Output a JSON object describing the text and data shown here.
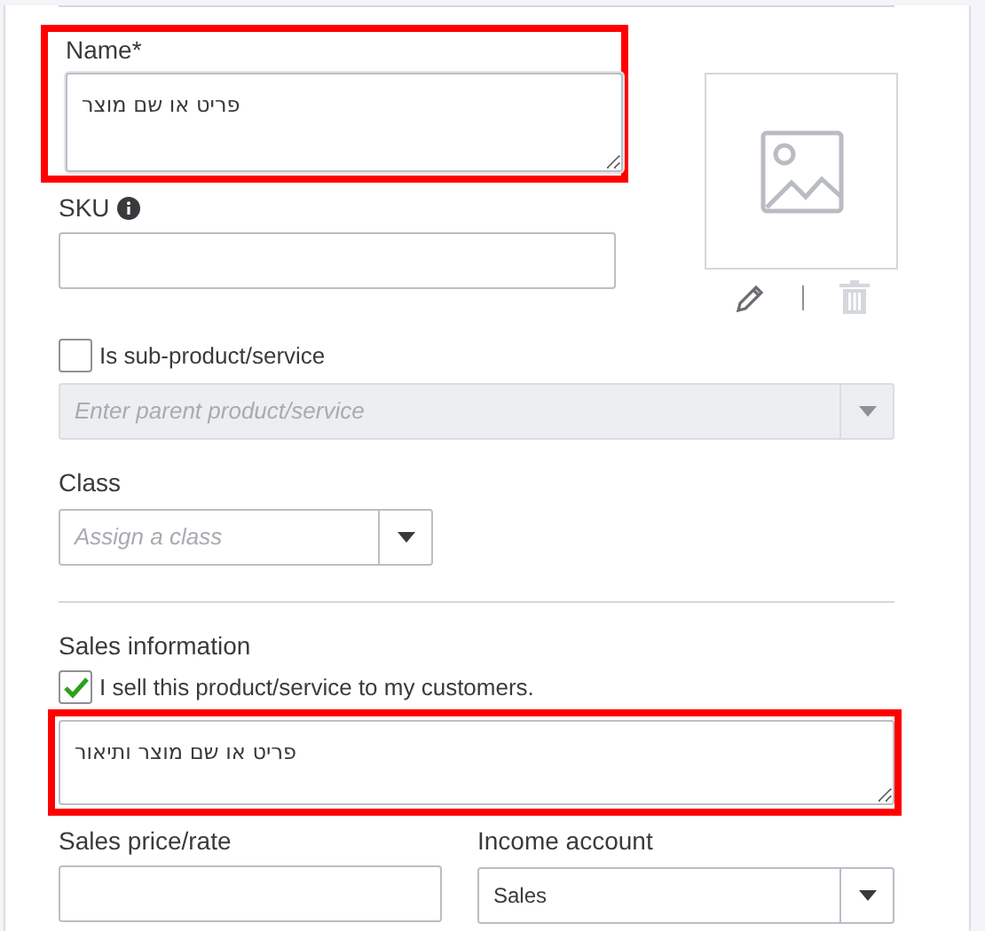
{
  "name_field": {
    "label": "Name*",
    "value": "פריט או שם מוצר",
    "highlighted": true
  },
  "sku_field": {
    "label": "SKU"
  },
  "sub_product": {
    "label": "Is sub-product/service",
    "checked": false
  },
  "parent_field": {
    "placeholder": "Enter parent product/service",
    "disabled": true
  },
  "class_field": {
    "label": "Class",
    "placeholder": "Assign a class"
  },
  "sales_section": {
    "title": "Sales information",
    "sell_checkbox": {
      "label": "I sell this product/service to my customers.",
      "checked": true
    },
    "description": {
      "value": "פריט או שם מוצר ותיאור",
      "highlighted": true
    },
    "price_field": {
      "label": "Sales price/rate"
    },
    "income_account": {
      "label": "Income account",
      "value": "Sales"
    }
  }
}
